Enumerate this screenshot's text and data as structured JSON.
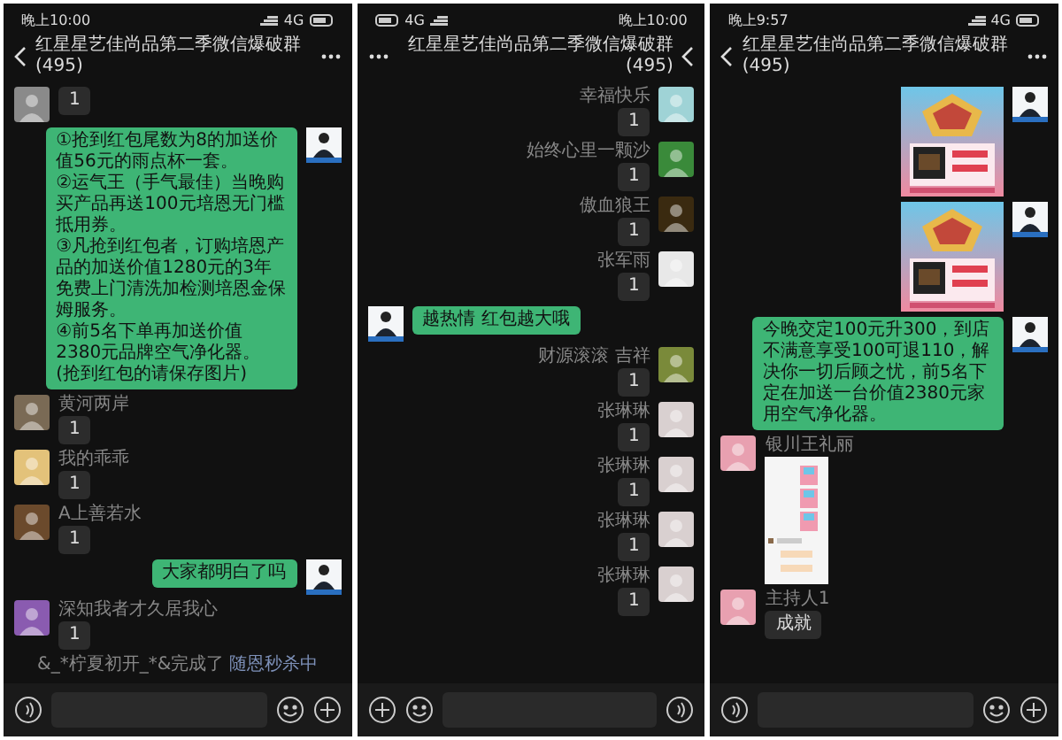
{
  "panels": [
    {
      "mirrored": false,
      "status": {
        "time": "晚上10:00",
        "network": "4G"
      },
      "title": "红星星艺佳尚品第二季微信爆破群(495)",
      "messages": [
        {
          "kind": "text",
          "outgoing": false,
          "color": "#8a8a8a",
          "text": "1"
        },
        {
          "kind": "text",
          "outgoing": true,
          "text": "①抢到红包尾数为8的加送价值56元的雨点杯一套。\n②运气王（手气最佳）当晚购买产品再送100元培恩无门槛抵用券。\n③凡抢到红包者，订购培恩产品的加送价值1280元的3年免费上门清洗加检测培恩金保姆服务。\n④前5名下单再加送价值2380元品牌空气净化器。\n(抢到红包的请保存图片)"
        },
        {
          "kind": "text",
          "outgoing": false,
          "color": "#7a6a55",
          "sender": "黄河两岸",
          "text": "1"
        },
        {
          "kind": "text",
          "outgoing": false,
          "color": "#e3c27a",
          "sender": "我的乖乖",
          "text": "1"
        },
        {
          "kind": "text",
          "outgoing": false,
          "color": "#6b4a2c",
          "sender": "A上善若水",
          "text": "1"
        },
        {
          "kind": "text",
          "outgoing": true,
          "text": "大家都明白了吗"
        },
        {
          "kind": "text",
          "outgoing": false,
          "color": "#8a5bb0",
          "sender": "深知我者才久居我心",
          "text": "1"
        },
        {
          "kind": "system",
          "text": "&_*柠夏初开_*&完成了",
          "link": "随恩秒杀中"
        }
      ]
    },
    {
      "mirrored": true,
      "status": {
        "time": "晚上10:00",
        "network": "4G"
      },
      "title": "红星星艺佳尚品第二季微信爆破群(495)",
      "messages": [
        {
          "kind": "text",
          "outgoing": false,
          "color": "#9fd3d6",
          "sender": "幸福快乐",
          "text": "1"
        },
        {
          "kind": "text",
          "outgoing": false,
          "color": "#3a8a3a",
          "sender": "始终心里一颗沙",
          "text": "1"
        },
        {
          "kind": "text",
          "outgoing": false,
          "color": "#3a2a10",
          "sender": "傲血狼王",
          "text": "1"
        },
        {
          "kind": "text",
          "outgoing": false,
          "color": "#e8e8e8",
          "sender": "张军雨",
          "text": "1"
        },
        {
          "kind": "text",
          "outgoing": true,
          "text": "越热情 红包越大哦"
        },
        {
          "kind": "text",
          "outgoing": false,
          "color": "#7a8a3a",
          "sender": "财源滚滚 吉祥",
          "text": "1"
        },
        {
          "kind": "text",
          "outgoing": false,
          "color": "#d9d0d0",
          "sender": "张琳琳",
          "text": "1"
        },
        {
          "kind": "text",
          "outgoing": false,
          "color": "#d9d0d0",
          "sender": "张琳琳",
          "text": "1"
        },
        {
          "kind": "text",
          "outgoing": false,
          "color": "#d9d0d0",
          "sender": "张琳琳",
          "text": "1"
        },
        {
          "kind": "text",
          "outgoing": false,
          "color": "#d9d0d0",
          "sender": "张琳琳",
          "text": "1"
        }
      ]
    },
    {
      "mirrored": false,
      "status": {
        "time": "晚上9:57",
        "network": "4G"
      },
      "title": "红星星艺佳尚品第二季微信爆破群(495)",
      "messages": [
        {
          "kind": "poster",
          "outgoing": true
        },
        {
          "kind": "poster",
          "outgoing": true
        },
        {
          "kind": "text",
          "outgoing": true,
          "text": "今晚交定100元升300，到店不满意享受100可退110，解决你一切后顾之忧，前5名下定在加送一台价值2380元家用空气净化器。"
        },
        {
          "kind": "screenshot",
          "outgoing": false,
          "color": "#e8a0b0",
          "sender": "银川王礼丽"
        },
        {
          "kind": "text",
          "outgoing": false,
          "color": "#e8a0b0",
          "sender": "主持人1",
          "text": "成就"
        }
      ]
    }
  ]
}
